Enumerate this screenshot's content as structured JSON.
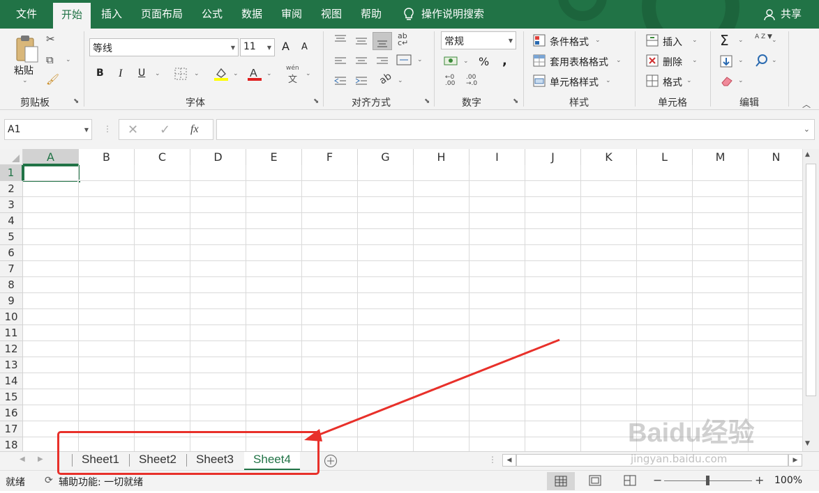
{
  "ribbon_tabs": [
    "文件",
    "开始",
    "插入",
    "页面布局",
    "公式",
    "数据",
    "审阅",
    "视图",
    "帮助"
  ],
  "tell_me": "操作说明搜索",
  "share": "共享",
  "clipboard": {
    "paste": "粘贴",
    "group": "剪贴板"
  },
  "font": {
    "name": "等线",
    "size": "11",
    "bold": "B",
    "italic": "I",
    "underline": "U",
    "grow": "A",
    "shrink": "A",
    "color_letter": "A",
    "wen": "wén",
    "wen_char": "文",
    "group": "字体"
  },
  "alignment": {
    "group": "对齐方式",
    "wrap": "ab"
  },
  "number": {
    "format": "常规",
    "percent": "%",
    "comma": ",",
    "group": "数字",
    "inc_decimal": ".00",
    "dec_decimal": ".00"
  },
  "styles": {
    "conditional": "条件格式",
    "table": "套用表格格式",
    "cell": "单元格样式",
    "group": "样式"
  },
  "cells": {
    "insert": "插入",
    "delete": "删除",
    "format": "格式",
    "group": "单元格"
  },
  "editing": {
    "sum": "Σ",
    "sort": "A Z",
    "group": "编辑"
  },
  "formula_bar": {
    "name_box": "A1",
    "fx": "fx",
    "content": ""
  },
  "columns": [
    "A",
    "B",
    "C",
    "D",
    "E",
    "F",
    "G",
    "H",
    "I",
    "J",
    "K",
    "L",
    "M",
    "N"
  ],
  "rows": [
    "1",
    "2",
    "3",
    "4",
    "5",
    "6",
    "7",
    "8",
    "9",
    "10",
    "11",
    "12",
    "13",
    "14",
    "15",
    "16",
    "17",
    "18"
  ],
  "selected_cell": "A1",
  "sheets": [
    "Sheet1",
    "Sheet2",
    "Sheet3",
    "Sheet4"
  ],
  "active_sheet": "Sheet4",
  "status": {
    "ready": "就绪",
    "accessibility": "辅助功能: 一切就绪",
    "zoom": "100%",
    "minus": "−",
    "plus": "+"
  },
  "watermark": {
    "brand": "Baidu经验",
    "url": "jingyan.baidu.com"
  },
  "colors": {
    "accent": "#217346",
    "annotation": "#e8302a"
  }
}
